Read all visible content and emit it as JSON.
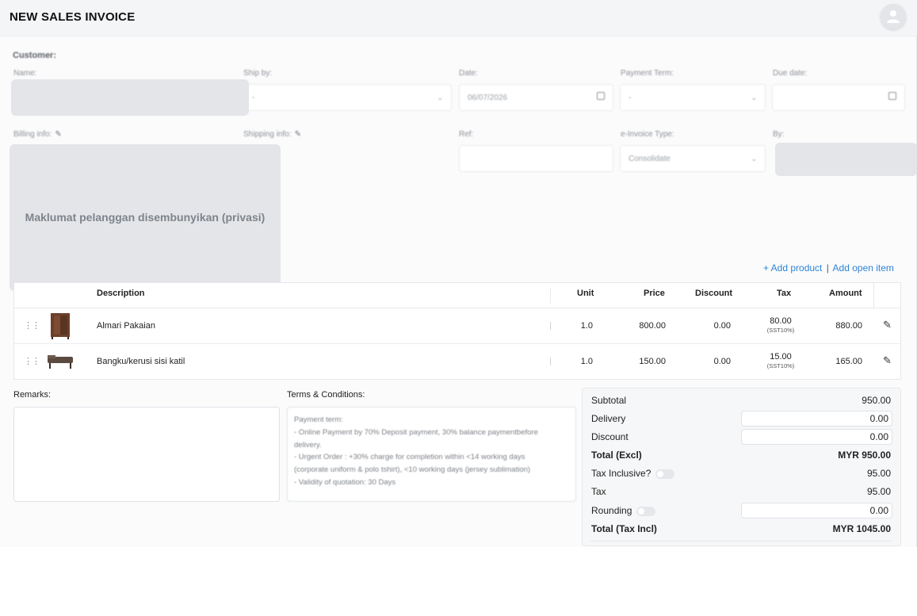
{
  "header": {
    "title": "NEW SALES INVOICE"
  },
  "form": {
    "customer_label": "Customer:",
    "name_label": "Name:",
    "ship_by_label": "Ship by:",
    "ship_by_value": "-",
    "date_label": "Date:",
    "date_value": "06/07/2026",
    "payment_term_label": "Payment Term:",
    "payment_term_value": "-",
    "due_date_label": "Due date:",
    "billing_label": "Billing info:",
    "shipping_label": "Shipping info:",
    "ref_label": "Ref:",
    "einvoice_label": "e-Invoice Type:",
    "einvoice_value": "Consolidate",
    "by_label": "By:",
    "privacy_notice": "Maklumat pelanggan disembunyikan (privasi)"
  },
  "actions": {
    "add_product": "+ Add product",
    "separator": "|",
    "add_open_item": "Add open item"
  },
  "table": {
    "headers": {
      "description": "Description",
      "unit": "Unit",
      "price": "Price",
      "discount": "Discount",
      "tax": "Tax",
      "amount": "Amount"
    },
    "rows": [
      {
        "description": "Almari Pakaian",
        "unit": "1.0",
        "price": "800.00",
        "discount": "0.00",
        "tax": "80.00",
        "tax_code": "(SST10%)",
        "amount": "880.00"
      },
      {
        "description": "Bangku/kerusi sisi katil",
        "unit": "1.0",
        "price": "150.00",
        "discount": "0.00",
        "tax": "15.00",
        "tax_code": "(SST10%)",
        "amount": "165.00"
      }
    ]
  },
  "remarks": {
    "label": "Remarks:",
    "value": ""
  },
  "terms": {
    "label": "Terms & Conditions:",
    "lines": [
      "Payment term:",
      "- Online Payment by 70% Deposit payment, 30% balance paymentbefore",
      "delivery.",
      "- Urgent Order : +30% charge for completion within <14 working days",
      "(corporate uniform & polo tshirt), <10 working days (jersey sublimation)",
      "- Validity of quotation: 30 Days"
    ]
  },
  "totals": {
    "subtotal_label": "Subtotal",
    "subtotal": "950.00",
    "delivery_label": "Delivery",
    "delivery": "0.00",
    "discount_label": "Discount",
    "discount": "0.00",
    "total_excl_label": "Total (Excl)",
    "total_excl": "MYR 950.00",
    "tax_inclusive_label": "Tax Inclusive?",
    "tax_inclusive_value": "95.00",
    "tax_inclusive_on": false,
    "tax_label": "Tax",
    "tax": "95.00",
    "rounding_label": "Rounding",
    "rounding": "0.00",
    "rounding_on": false,
    "total_incl_label": "Total (Tax Incl)",
    "total_incl": "MYR 1045.00"
  },
  "colors": {
    "link": "#2e84d6",
    "mask": "#e3e5e9"
  }
}
